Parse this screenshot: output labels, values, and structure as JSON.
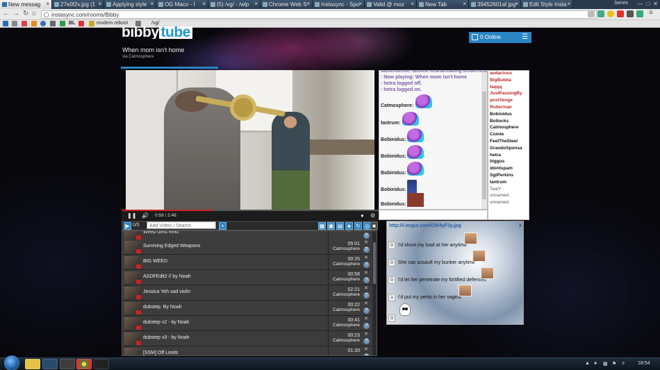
{
  "browser": {
    "tabs": [
      {
        "label": "New messag",
        "active": true
      },
      {
        "label": "27e0f2v.jpg (1",
        "active": false
      },
      {
        "label": "Applying style",
        "active": false
      },
      {
        "label": "OG Maco - I",
        "active": false
      },
      {
        "label": "(5) /vg/ - /wlp",
        "active": false
      },
      {
        "label": "Chrome Web S",
        "active": false
      },
      {
        "label": "Instasync - Spo",
        "active": false
      },
      {
        "label": "Valid @ moz",
        "active": false
      },
      {
        "label": "New Tab",
        "active": false
      },
      {
        "label": "39452601af.jpg",
        "active": false
      },
      {
        "label": "Edit Style Insta",
        "active": false
      }
    ],
    "user": "James",
    "url": "instasync.com/rooms/Bibby",
    "bookmarks": {
      "b1": "BL",
      "b2": "modem.reboot",
      "b3": "/vg/"
    }
  },
  "room": {
    "logo_left": "bibby",
    "logo_right": "tube",
    "title": "When mom isn't home",
    "via": "via Catmosphere",
    "online_label": "0 Online"
  },
  "player": {
    "time": "0:59 / 2:46",
    "progress": 0.355
  },
  "chat": {
    "system": [
      "banterbeetle: almost heartbreaking tenderness",
      ": Now playing: When mom isn't home",
      ": hetra logged off.",
      ": hetra logged on."
    ],
    "messages": [
      {
        "user": "Catmosphere:",
        "emote": "purple-slime-emote"
      },
      {
        "user": "tantrum:",
        "emote": "purple-slime-emote"
      },
      {
        "user": "Bobinidus:",
        "emote": "purple-slime-emote"
      },
      {
        "user": "Bobinidus:",
        "emote": "purple-slime-emote"
      },
      {
        "user": "Bobinidus:",
        "emote": "purple-slime-emote"
      },
      {
        "user": "Bobinidus:",
        "emote": "pixel-sprite-emote"
      },
      {
        "user": "Bobinidus:",
        "emote": "photo-emote"
      }
    ]
  },
  "users": [
    {
      "name": "audacious",
      "color": "#b5262a"
    },
    {
      "name": "BigBubba",
      "color": "#b5262a"
    },
    {
      "name": "faqqq",
      "color": "#b5262a"
    },
    {
      "name": "JustPassingBy",
      "color": "#b5262a"
    },
    {
      "name": "postVenge",
      "color": "#b5262a"
    },
    {
      "name": "Rollernian",
      "color": "#b5262a"
    },
    {
      "name": "Bobinidus",
      "color": "#111111"
    },
    {
      "name": "Bollocks",
      "color": "#111111"
    },
    {
      "name": "Catmosphere",
      "color": "#111111"
    },
    {
      "name": "Comte",
      "color": "#111111"
    },
    {
      "name": "FeelTheSteel",
      "color": "#111111"
    },
    {
      "name": "GrandoSponsa",
      "color": "#111111"
    },
    {
      "name": "hetra",
      "color": "#111111"
    },
    {
      "name": "higgus",
      "color": "#111111"
    },
    {
      "name": "idontspam",
      "color": "#111111"
    },
    {
      "name": "SgtPerkins",
      "color": "#111111"
    },
    {
      "name": "tantrum",
      "color": "#111111"
    },
    {
      "name": "TastY",
      "color": "#555555"
    },
    {
      "name": "unnamed",
      "color": "#555555"
    },
    {
      "name": "unnamed",
      "color": "#555555"
    }
  ],
  "playlist": {
    "count": "0/5",
    "add_placeholder": "Add Video / Search",
    "items": [
      {
        "title": "Weed Gets Rekt",
        "duration": "",
        "added_by": "Catmosphere"
      },
      {
        "title": "Surviving Edged Weapons",
        "duration": "05:01",
        "added_by": "Catmosphere"
      },
      {
        "title": "BIG WEED",
        "duration": "00:25",
        "added_by": "Catmosphere"
      },
      {
        "title": "ASDFEdit2 // by Noah",
        "duration": "00:58",
        "added_by": "Catmosphere"
      },
      {
        "title": "Jessica Yeh sad violin",
        "duration": "02:21",
        "added_by": "Catmosphere"
      },
      {
        "title": "dubstep. By Noah",
        "duration": "00:22",
        "added_by": "Catmosphere"
      },
      {
        "title": "dubstep v2 - by Noah",
        "duration": "00:41",
        "added_by": "Catmosphere"
      },
      {
        "title": "dubstep v3 - by Noah",
        "duration": "00:23",
        "added_by": "Catmosphere"
      },
      {
        "title": "[SSM] Off Limits",
        "duration": "01:20",
        "added_by": ""
      }
    ]
  },
  "poll": {
    "link": "http://i.imgur.com/OM4yF3y.jpg",
    "close": "x",
    "options": [
      {
        "votes": "0",
        "text": "I'd shoot my load at her anytime"
      },
      {
        "votes": "0",
        "text": "She can assault my bunker anytime"
      },
      {
        "votes": "0",
        "text": "I'd let her penetrate my fortified defences"
      },
      {
        "votes": "1",
        "text": "I'd put my penis in her vagina"
      },
      {
        "votes": "0",
        "text": ""
      }
    ]
  },
  "taskbar": {
    "clock": "18:54"
  }
}
